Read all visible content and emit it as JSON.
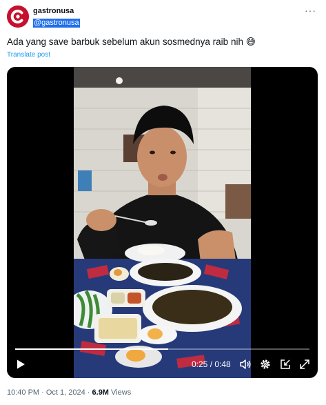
{
  "post": {
    "display_name": "gastronusa",
    "handle": "@gastronusa",
    "more_glyph": "···",
    "text": "Ada yang save barbuk sebelum akun sosmednya raib nih 😅",
    "translate_label": "Translate post"
  },
  "video": {
    "time_current": "0:25",
    "time_separator": " / ",
    "time_total": "0:48",
    "progress": 0.52
  },
  "meta": {
    "timestamp": "10:40 PM · Oct 1, 2024",
    "separator": " · ",
    "views_count": "6.9M",
    "views_label": "Views"
  },
  "colors": {
    "brand_red": "#c8102e",
    "link_blue": "#1d9bf0",
    "selection_blue": "#1f6feb"
  },
  "icons": [
    "more-icon",
    "play-icon",
    "volume-icon",
    "settings-icon",
    "exit-icon",
    "fullscreen-icon"
  ]
}
